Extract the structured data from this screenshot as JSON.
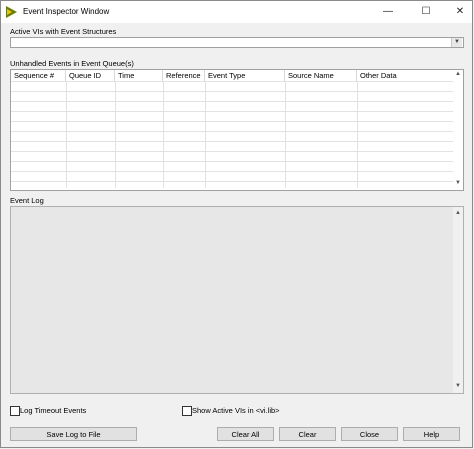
{
  "window": {
    "title": "Event Inspector Window"
  },
  "titlebar_controls": {
    "minimize": "—",
    "maximize": "☐",
    "close": "✕"
  },
  "active_vis": {
    "label": "Active VIs with Event Structures",
    "selected_value": ""
  },
  "unhandled": {
    "label": "Unhandled Events in Event Queue(s)",
    "columns": [
      "Sequence #",
      "Queue ID",
      "Time",
      "Reference",
      "Event Type",
      "Source Name",
      "Other Data"
    ],
    "rows": []
  },
  "event_log": {
    "label": "Event Log"
  },
  "options": {
    "log_timeout": {
      "label": "Log Timeout Events",
      "checked": false
    },
    "show_active": {
      "label": "Show Active VIs in <vi.lib>",
      "checked": false
    }
  },
  "buttons": {
    "save_log": "Save Log to File",
    "clear_all": "Clear All",
    "clear": "Clear",
    "close": "Close",
    "help": "Help"
  },
  "icons": {
    "app": "labview-arrow-icon",
    "dropdown": "chevron-down-icon"
  },
  "colors": {
    "icon_olive": "#6b7b0e",
    "icon_yellow": "#e8c800",
    "log_bg": "#e7e7e7"
  }
}
